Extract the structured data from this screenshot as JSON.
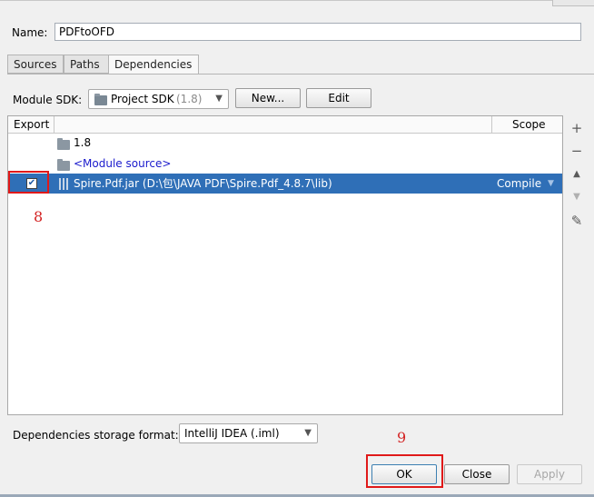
{
  "name": {
    "label": "Name:",
    "value": "PDFtoOFD"
  },
  "tabs": [
    {
      "label": "Sources"
    },
    {
      "label": "Paths"
    },
    {
      "label": "Dependencies",
      "active": true
    }
  ],
  "module_sdk": {
    "label": "Module SDK:",
    "selected": "Project SDK",
    "selected_hint": "(1.8)",
    "new_button": "New...",
    "edit_button": "Edit"
  },
  "table": {
    "columns": {
      "export": "Export",
      "scope": "Scope"
    },
    "rows": [
      {
        "text": "1.8",
        "icon": "folder-icon"
      },
      {
        "text": "<Module source>",
        "icon": "folder-icon",
        "link": true
      },
      {
        "text": "Spire.Pdf.jar (D:\\包\\JAVA PDF\\Spire.Pdf_4.8.7\\lib)",
        "icon": "jar-icon",
        "scope": "Compile",
        "checked": true,
        "selected": true
      }
    ],
    "checkbox_mark": "✔"
  },
  "side_toolbar": [
    {
      "icon": "add-icon",
      "glyph": "+"
    },
    {
      "icon": "remove-icon",
      "glyph": "−"
    },
    {
      "icon": "move-up-icon",
      "glyph": "▲"
    },
    {
      "icon": "move-down-icon",
      "glyph": "▼"
    },
    {
      "icon": "edit-icon",
      "glyph": "✎"
    }
  ],
  "storage": {
    "label": "Dependencies storage format:",
    "selected": "IntelliJ IDEA (.iml)"
  },
  "buttons": {
    "ok": "OK",
    "close": "Close",
    "apply": "Apply"
  },
  "annotations": {
    "step8": "8",
    "step9": "9"
  },
  "colors": {
    "selection": "#2f6fb7",
    "annotation": "#e01919",
    "link": "#1a1acd"
  }
}
